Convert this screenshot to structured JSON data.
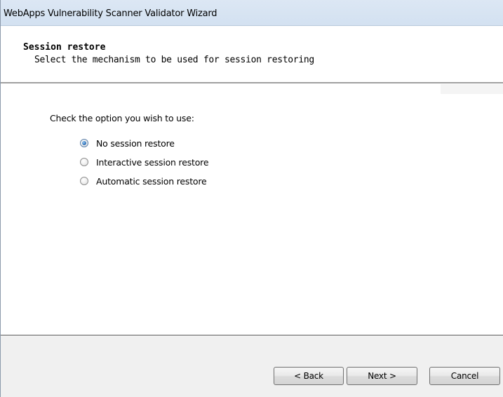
{
  "window": {
    "title": "WebApps Vulnerability Scanner Validator Wizard"
  },
  "header": {
    "title": "Session restore",
    "subtitle": "Select the mechanism to be used for session restoring"
  },
  "main": {
    "instruction": "Check the option you wish to use:",
    "options": [
      {
        "label": "No session restore",
        "checked": true
      },
      {
        "label": "Interactive session restore",
        "checked": false
      },
      {
        "label": "Automatic session restore",
        "checked": false
      }
    ]
  },
  "footer": {
    "back_label": "< Back",
    "next_label": "Next >",
    "cancel_label": "Cancel"
  },
  "colors": {
    "titlebar": "#d3e1f1",
    "dialog_background": "#f0f0f0",
    "content_background": "#ffffff",
    "radio_selected": "#2b6bb3"
  }
}
